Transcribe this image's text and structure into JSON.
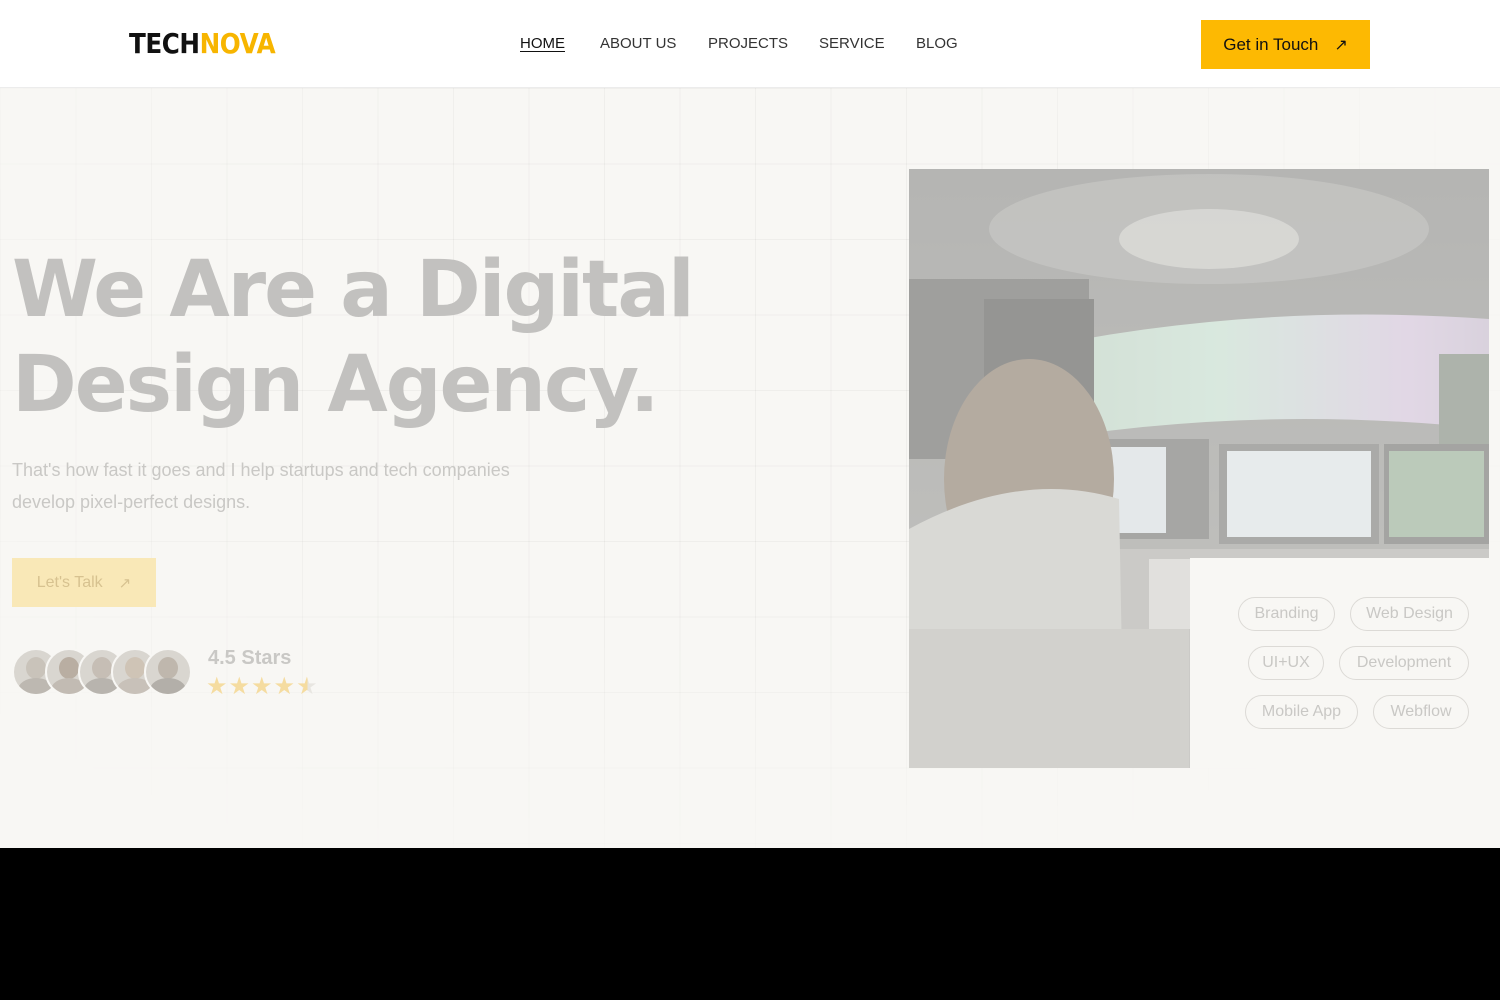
{
  "header": {
    "logo": {
      "part1": "TECH",
      "part2": "NOVA"
    },
    "nav": [
      {
        "label": "HOME",
        "active": true
      },
      {
        "label": "ABOUT US",
        "active": false
      },
      {
        "label": "PROJECTS",
        "active": false
      },
      {
        "label": "SERVICE",
        "active": false
      },
      {
        "label": "BLOG",
        "active": false
      }
    ],
    "cta": {
      "label": "Get in Touch",
      "icon": "arrow-up-right-icon"
    }
  },
  "hero": {
    "headline_line1": "We Are a Digital",
    "headline_line2": "Design Agency.",
    "subtext": "That's how fast it goes and I help startups and tech companies develop pixel-perfect designs.",
    "button": {
      "label": "Let's Talk",
      "icon": "arrow-up-right-icon"
    },
    "rating": {
      "label": "4.5 Stars",
      "value": 4.5,
      "max": 5
    },
    "avatars_count": 5,
    "tags": [
      "Branding",
      "Web Design",
      "UI+UX",
      "Development",
      "Mobile App",
      "Webflow"
    ]
  },
  "colors": {
    "accent": "#fdb902",
    "background": "#f8f7f4",
    "headline": "#c2c1bf"
  }
}
